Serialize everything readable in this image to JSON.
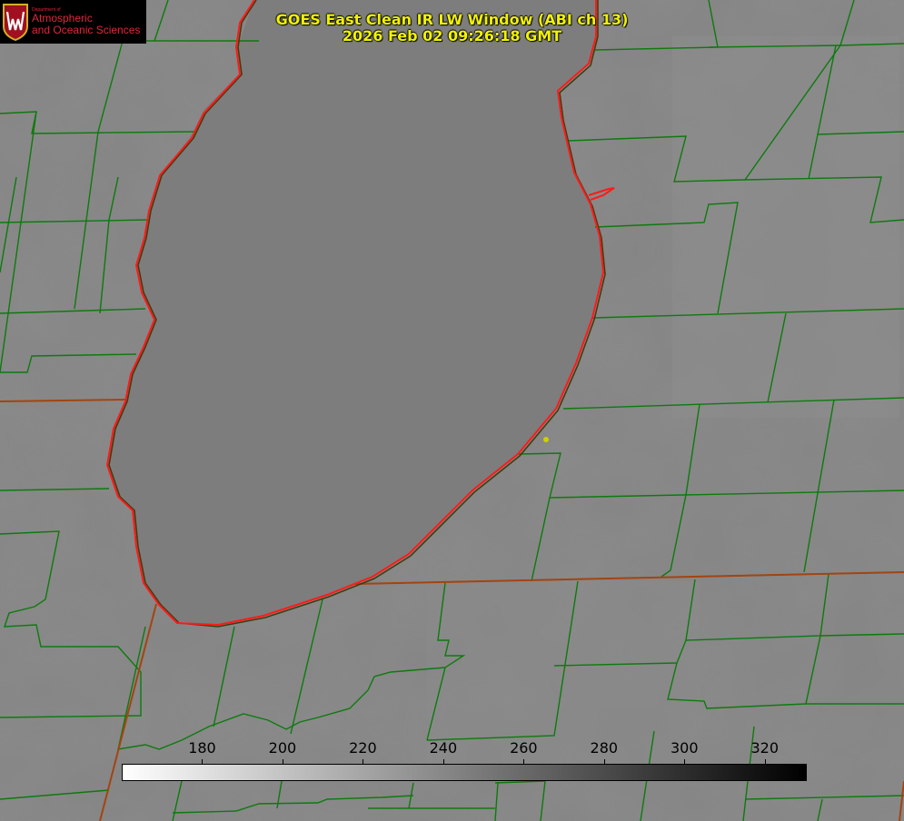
{
  "title": {
    "line1": "GOES East Clean IR LW Window (ABI ch 13)",
    "line2": "2026 Feb 02 09:26:18 GMT"
  },
  "logo": {
    "dept": "Department of",
    "line1": "Atmospheric",
    "line2": "and Oceanic Sciences",
    "crest_letter": "W"
  },
  "colors": {
    "background": "#848484",
    "lake": "#7f7f7f",
    "county_borders": "#0d7a0d",
    "state_borders": "#a34412",
    "coastline": "#ff1a1a",
    "title_text": "#f2f200",
    "logo_text": "#e0273a"
  },
  "colorbar": {
    "range": [
      160,
      330
    ],
    "scale": "white to black",
    "tick_labels": [
      "180",
      "200",
      "220",
      "240",
      "260",
      "280",
      "300",
      "320"
    ],
    "tick_values": [
      180,
      200,
      220,
      240,
      260,
      280,
      300,
      320
    ]
  }
}
